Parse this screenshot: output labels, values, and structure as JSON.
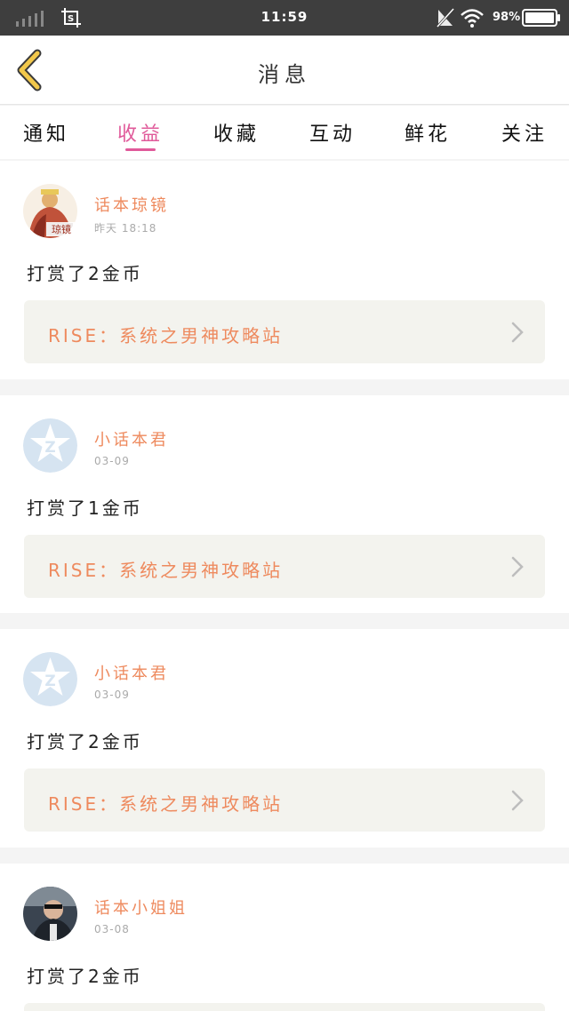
{
  "status_bar": {
    "time": "11:59",
    "battery": "98",
    "battery_icon": "battery-icon",
    "wifi_icon": "wifi-icon",
    "mute_icon": "mute-icon",
    "signal_icon": "signal-icon",
    "screenshot_icon": "screenshot-icon"
  },
  "header": {
    "title": "消息",
    "back_icon": "chevron-left-icon"
  },
  "tabs": [
    {
      "label": "通知"
    },
    {
      "label": "收益",
      "active": true
    },
    {
      "label": "收藏"
    },
    {
      "label": "互动"
    },
    {
      "label": "鲜花"
    },
    {
      "label": "关注"
    }
  ],
  "messages": [
    {
      "user": "话本琼镜",
      "time": "昨天 18:18",
      "text": "打赏了2金币",
      "link": "RISE：系统之男神攻略站",
      "avatar_label": "琼镜"
    },
    {
      "user": "小话本君",
      "time": "03-09",
      "text": "打赏了1金币",
      "link": "RISE：系统之男神攻略站",
      "avatar_label": ""
    },
    {
      "user": "小话本君",
      "time": "03-09",
      "text": "打赏了2金币",
      "link": "RISE：系统之男神攻略站",
      "avatar_label": ""
    },
    {
      "user": "话本小姐姐",
      "time": "03-08",
      "text": "打赏了2金币",
      "link": "",
      "avatar_label": ""
    }
  ],
  "colors": {
    "accent": "#e05a9a",
    "name": "#ee8a5e",
    "back_arrow": "#f2c84b",
    "statusbar": "#3e3e3e"
  }
}
